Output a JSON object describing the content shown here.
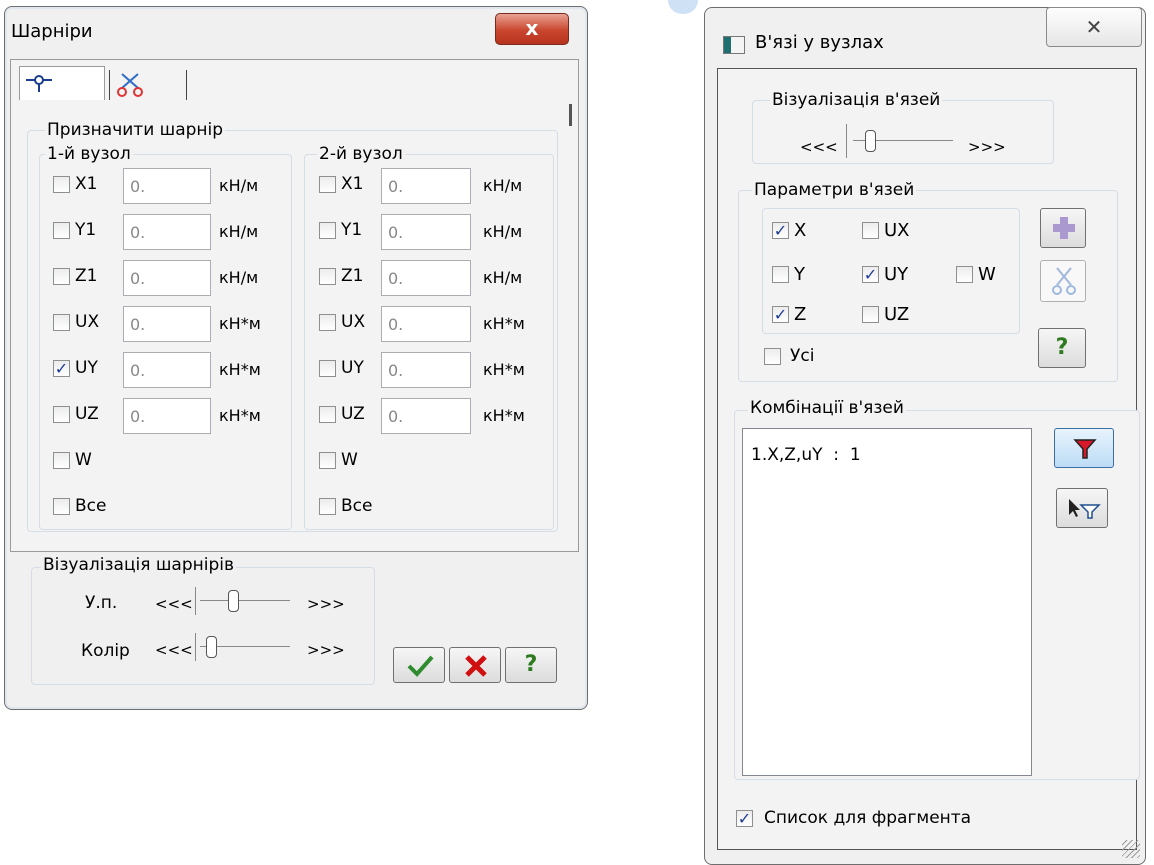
{
  "hinges": {
    "title": "Шарніри",
    "close_label": "x",
    "assign_group": "Призначити шарнір",
    "node1_title": "1-й вузол",
    "node2_title": "2-й вузол",
    "rows": [
      {
        "label": "X1",
        "value1": "0.",
        "unit1": "кН/м",
        "value2": "0.",
        "unit2": "кН/м",
        "checked1": false
      },
      {
        "label": "Y1",
        "value1": "0.",
        "unit1": "кН/м",
        "value2": "0.",
        "unit2": "кН/м",
        "checked1": false
      },
      {
        "label": "Z1",
        "value1": "0.",
        "unit1": "кН/м",
        "value2": "0.",
        "unit2": "кН/м",
        "checked1": false
      },
      {
        "label": "UX",
        "value1": "0.",
        "unit1": "кН*м",
        "value2": "0.",
        "unit2": "кН*м",
        "checked1": false
      },
      {
        "label": "UY",
        "value1": "0.",
        "unit1": "кН*м",
        "value2": "0.",
        "unit2": "кН*м",
        "checked1": true
      },
      {
        "label": "UZ",
        "value1": "0.",
        "unit1": "кН*м",
        "value2": "0.",
        "unit2": "кН*м",
        "checked1": false
      },
      {
        "label": "W"
      }
    ],
    "all_label": "Все",
    "viz_group": "Візуалізація шарнірів",
    "scale_label": "У.п.",
    "color_label": "Колір",
    "arrow_left": "<<<",
    "arrow_right": ">>>",
    "help_label": "?"
  },
  "constraints": {
    "title": "В'язі у вузлах",
    "close_label": "✕",
    "viz_group": "Візуалізація в'язей",
    "arrow_left": "<<<",
    "arrow_right": ">>>",
    "params_group": "Параметри в'язей",
    "params": [
      {
        "label": "X",
        "checked": true
      },
      {
        "label": "UX",
        "checked": false
      },
      {
        "label": "Y",
        "checked": false
      },
      {
        "label": "UY",
        "checked": true
      },
      {
        "label": "W",
        "checked": false
      },
      {
        "label": "Z",
        "checked": true
      },
      {
        "label": "UZ",
        "checked": false
      }
    ],
    "all_label": "Усі",
    "combos_group": "Комбінації в'язей",
    "combos": [
      "1.X,Z,uY  :  1"
    ],
    "help_label": "?",
    "fragment_label": "Список для фрагмента",
    "fragment_checked": true
  }
}
